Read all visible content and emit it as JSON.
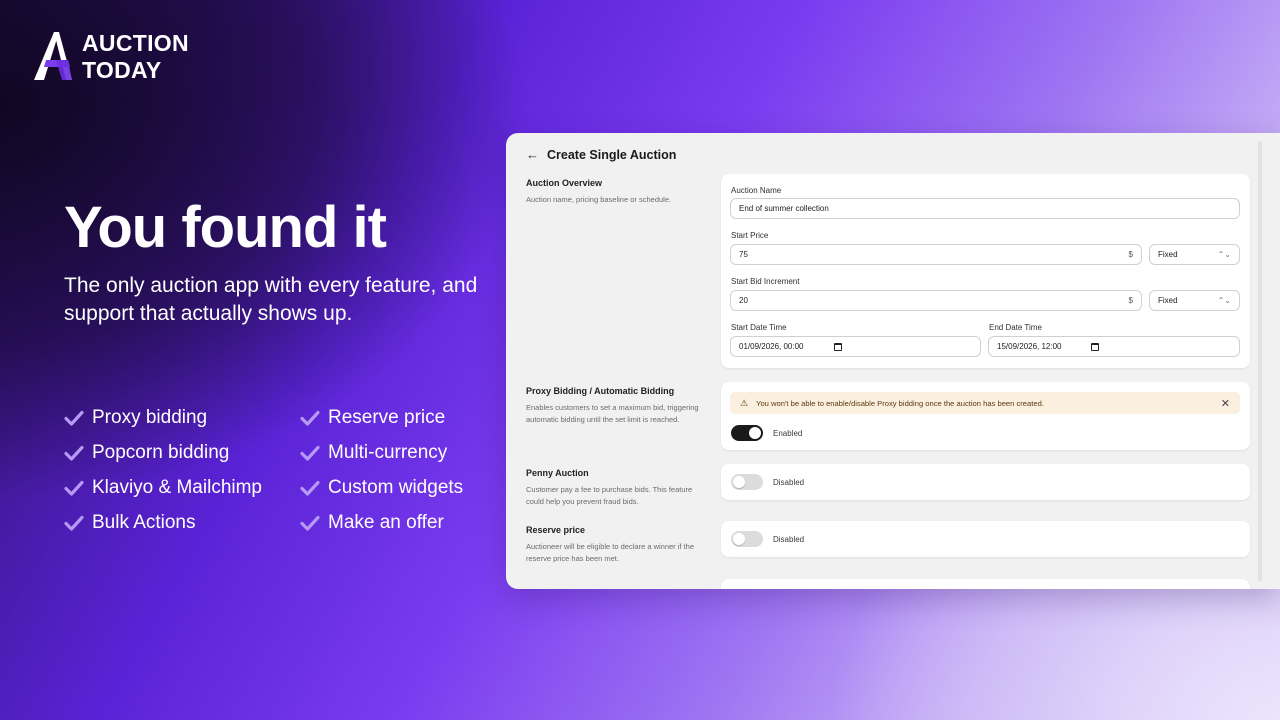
{
  "brand": {
    "line1": "AUCTION",
    "line2": "TODAY"
  },
  "hero": {
    "title": "You found it",
    "subtitle": "The only auction app with every feature, and support that actually shows up."
  },
  "features": [
    "Proxy bidding",
    "Reserve price",
    "Popcorn bidding",
    "Multi-currency",
    "Klaviyo & Mailchimp",
    "Custom widgets",
    "Bulk Actions",
    "Make an offer"
  ],
  "app": {
    "title": "Create Single Auction",
    "overview": {
      "title": "Auction Overview",
      "desc": "Auction name, pricing baseline or schedule.",
      "name_label": "Auction Name",
      "name_value": "End of summer collection",
      "start_price_label": "Start Price",
      "start_price_value": "75",
      "currency_suffix": "$",
      "start_price_type": "Fixed",
      "increment_label": "Start Bid Increment",
      "increment_value": "20",
      "increment_type": "Fixed",
      "start_date_label": "Start Date Time",
      "start_date_value": "01/09/2026, 00:00",
      "end_date_label": "End Date Time",
      "end_date_value": "15/09/2026, 12:00"
    },
    "proxy": {
      "title": "Proxy Bidding / Automatic Bidding",
      "desc": "Enables customers to set a maximum bid, triggering automatic bidding until the set limit is reached.",
      "warning": "You won't be able to enable/disable Proxy bidding once the auction has been created.",
      "status": "Enabled"
    },
    "penny": {
      "title": "Penny Auction",
      "desc": "Customer pay a fee to purchase bids. This feature could help you prevent fraud bids.",
      "status": "Disabled"
    },
    "reserve": {
      "title": "Reserve price",
      "desc": "Auctioneer will be eligible to declare a winner if the reserve price has been met.",
      "status": "Disabled"
    }
  },
  "colors": {
    "accent": "#7b3cf0",
    "check": "#b69af5"
  }
}
